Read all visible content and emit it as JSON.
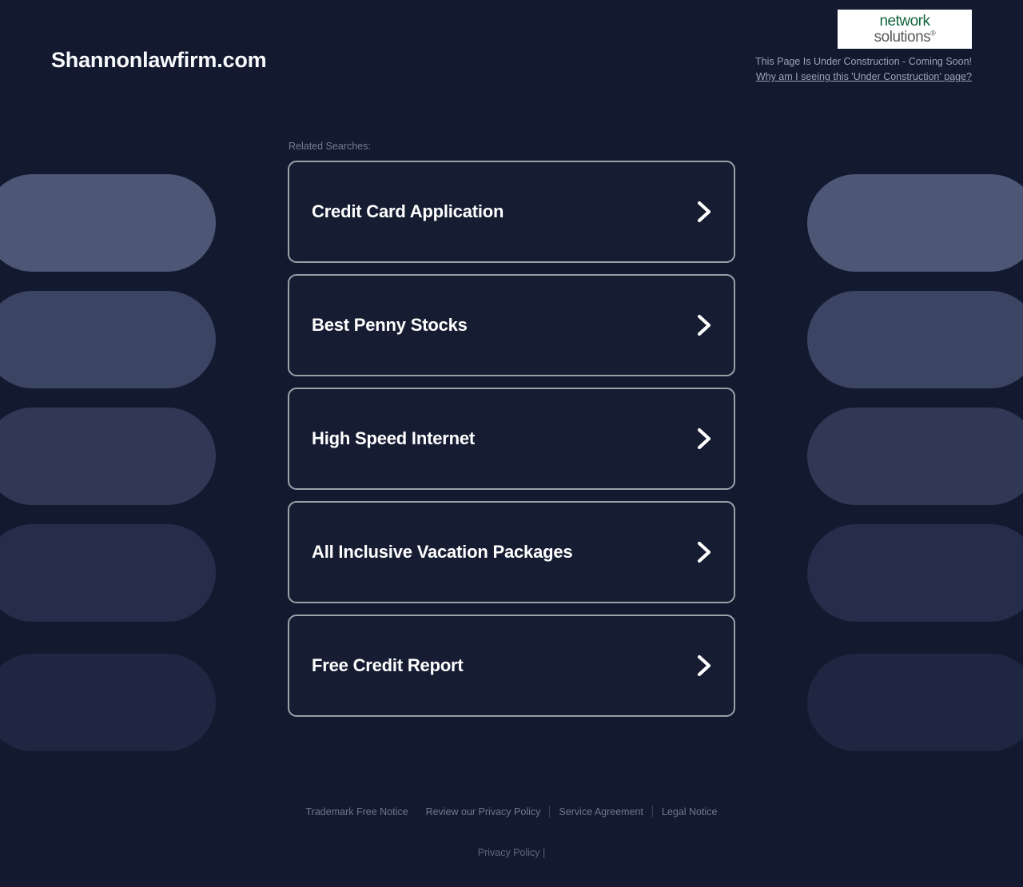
{
  "header": {
    "site_title": "Shannonlawfirm.com",
    "logo": {
      "name": "network-solutions-logo",
      "line1": "network",
      "line2": "solutions",
      "registered_mark": "®",
      "color_line1": "#14653c",
      "color_line2": "#595959",
      "background": "#ffffff"
    },
    "construction_notice": "This Page Is Under Construction - Coming Soon!",
    "construction_link": "Why am I seeing this 'Under Construction' page?"
  },
  "main": {
    "related_label": "Related Searches:",
    "chevron_icon": "chevron-right-icon",
    "searches": [
      {
        "label": "Credit Card Application"
      },
      {
        "label": "Best Penny Stocks"
      },
      {
        "label": "High Speed Internet"
      },
      {
        "label": "All Inclusive Vacation Packages"
      },
      {
        "label": "Free Credit Report"
      }
    ]
  },
  "footer": {
    "links": [
      {
        "label": "Trademark Free Notice"
      },
      {
        "label": "Review our Privacy Policy"
      },
      {
        "label": "Service Agreement"
      },
      {
        "label": "Legal Notice"
      }
    ],
    "separators_after": [
      1,
      2
    ],
    "bottom_link": "Privacy Policy",
    "bottom_suffix": "|"
  },
  "theme": {
    "background": "#131a30",
    "card_background": "#161d33",
    "card_border": "#9aa0a8",
    "text_primary": "#ffffff",
    "text_muted": "#6e7791"
  },
  "decor": {
    "pill_colors": [
      "#4d5675",
      "#3c4463",
      "#303855",
      "#252d4a",
      "#1e2642"
    ],
    "pill_tops": [
      218,
      364,
      510,
      656,
      818
    ]
  }
}
